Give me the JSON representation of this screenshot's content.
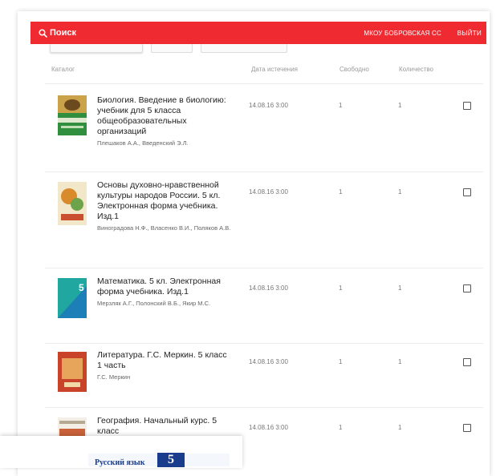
{
  "header": {
    "search_label": "Поиск",
    "organization": "МКОУ БОБРОВСКАЯ СС",
    "logout_label": "ВЫЙТИ",
    "accent_color": "#ef2a31"
  },
  "table": {
    "columns": {
      "catalog": "Каталог",
      "expiry_date": "Дата истечения",
      "free": "Свободно",
      "quantity": "Количество"
    },
    "rows": [
      {
        "title": "Биология. Введение в биологию: учебник для 5 класса общеобразовательных организаций",
        "authors": "Плешаков А.А., Введенский Э.Л.",
        "date": "14.08.16 3:00",
        "free": "1",
        "quantity": "1",
        "checked": false
      },
      {
        "title": "Основы духовно-нравственной культуры народов России. 5 кл. Электронная форма учебника. Изд.1",
        "authors": "Виноградова Н.Ф., Власенко В.И., Поляков А.В.",
        "date": "14.08.16 3:00",
        "free": "1",
        "quantity": "1",
        "checked": false
      },
      {
        "title": "Математика. 5 кл. Электронная форма учебника. Изд.1",
        "authors": "Мерзляк А.Г., Полонский В.Б., Якир М.С.",
        "date": "14.08.16 3:00",
        "free": "1",
        "quantity": "1",
        "checked": false
      },
      {
        "title": "Литература. Г.С. Меркин. 5 класс 1 часть",
        "authors": "Г.С. Меркин",
        "date": "14.08.16 3:00",
        "free": "1",
        "quantity": "1",
        "checked": false
      },
      {
        "title": "География. Начальный курс. 5 класс",
        "authors": "",
        "date": "14.08.16 3:00",
        "free": "1",
        "quantity": "1",
        "checked": false
      }
    ]
  },
  "bottom_preview": {
    "title": "Русский язык",
    "grade": "5"
  }
}
